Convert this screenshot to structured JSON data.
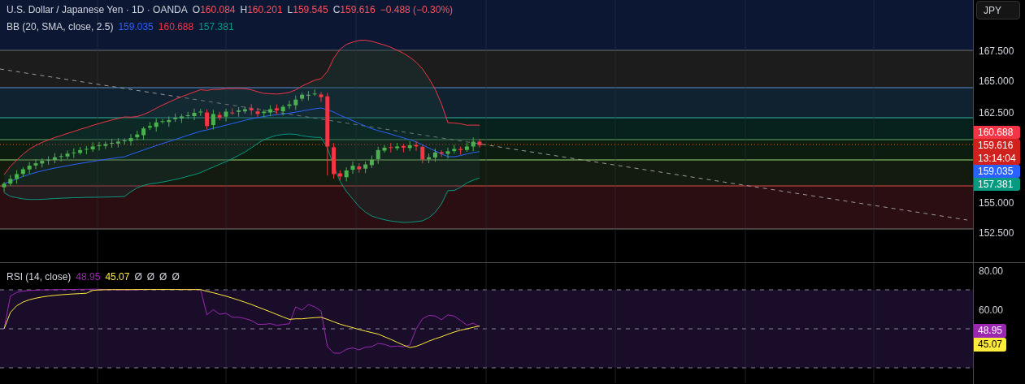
{
  "legend": {
    "title": "U.S. Dollar / Japanese Yen · 1D · OANDA",
    "ohlc": [
      {
        "label": "O",
        "value": "160.084"
      },
      {
        "label": "H",
        "value": "160.201"
      },
      {
        "label": "L",
        "value": "159.545"
      },
      {
        "label": "C",
        "value": "159.616"
      }
    ],
    "change": "−0.488 (−0.30%)",
    "color": "#f7525f"
  },
  "bollinger": {
    "label": "BB (20, SMA, close, 2.5)",
    "values": [
      {
        "text": "159.035",
        "color": "#2962ff"
      },
      {
        "text": "160.688",
        "color": "#f23645"
      },
      {
        "text": "157.381",
        "color": "#089981"
      }
    ]
  },
  "currency_button": "JPY",
  "price_ticks": [
    "167.500",
    "165.000",
    "162.500",
    "155.000",
    "152.500"
  ],
  "price_badges": [
    {
      "text": "160.688",
      "color": "#f23645"
    },
    {
      "text": "159.616",
      "sub": "13:14:04",
      "color": "#d1211e"
    },
    {
      "text": "159.035",
      "color": "#2962ff"
    },
    {
      "text": "157.381",
      "color": "#089981"
    }
  ],
  "rsi": {
    "label": "RSI (14, close)",
    "values": [
      {
        "text": "48.95",
        "color": "#9c27b0"
      },
      {
        "text": "45.07",
        "color": "#ffeb3b"
      }
    ],
    "extras": [
      "Ø",
      "Ø",
      "Ø",
      "Ø"
    ]
  },
  "rsi_ticks": [
    "80.00",
    "60.00"
  ],
  "rsi_badges": [
    {
      "text": "48.95",
      "color": "#9c27b0"
    },
    {
      "text": "45.07",
      "color": "#ffeb3b"
    }
  ]
}
